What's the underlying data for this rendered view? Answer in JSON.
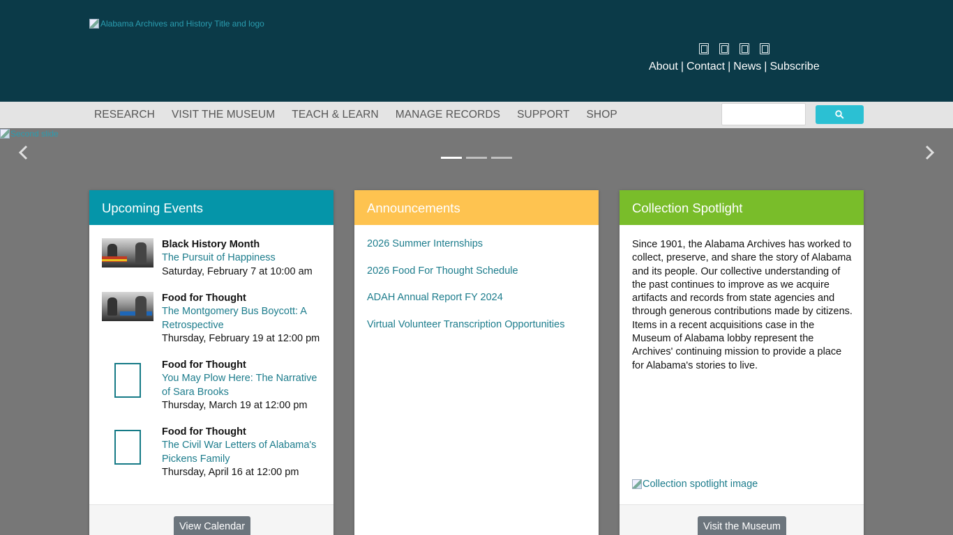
{
  "header": {
    "logo_alt": "Alabama Archives and History Title and logo",
    "social_icons": [
      "facebook-icon",
      "twitter-icon",
      "instagram-icon",
      "youtube-icon"
    ],
    "links": [
      "About",
      "Contact",
      "News",
      "Subscribe"
    ]
  },
  "nav": {
    "items": [
      "RESEARCH",
      "VISIT THE MUSEUM",
      "TEACH & LEARN",
      "MANAGE RECORDS",
      "SUPPORT",
      "SHOP"
    ],
    "search_value": ""
  },
  "carousel": {
    "slide_alt": "Second slide",
    "slide_count": 3,
    "active_index": 0
  },
  "events": {
    "title": "Upcoming Events",
    "items": [
      {
        "category": "Black History Month",
        "title": "The Pursuit of Happiness",
        "date": "Saturday, February 7 at 10:00 am"
      },
      {
        "category": "Food for Thought",
        "title": "The Montgomery Bus Boycott: A Retrospective",
        "date": "Thursday, February 19 at 12:00 pm"
      },
      {
        "category": "Food for Thought",
        "title": "You May Plow Here: The Narrative of Sara Brooks",
        "date": "Thursday, March 19 at 12:00 pm"
      },
      {
        "category": "Food for Thought",
        "title": "The Civil War Letters of Alabama's Pickens Family",
        "date": "Thursday, April 16 at 12:00 pm"
      }
    ],
    "button": "View Calendar"
  },
  "announcements": {
    "title": "Announcements",
    "items": [
      "2026 Summer Internships",
      "2026 Food For Thought Schedule",
      "ADAH Annual Report FY 2024",
      "Virtual Volunteer Transcription Opportunities"
    ]
  },
  "spotlight": {
    "title": "Collection Spotlight",
    "text": "Since 1901, the Alabama Archives has worked to collect, preserve, and share the story of Alabama and its people. Our collective understanding of the past continues to improve as we acquire artifacts and records from state agencies and through generous contributions made by citizens. Items in a recent acquisitions case in the Museum of Alabama lobby represent the Archives' continuing mission to provide a place for Alabama's stories to live.",
    "image_alt": "Collection spotlight image",
    "button": "Visit the Museum"
  },
  "colors": {
    "header_bg": "#0b3a48",
    "events_accent": "#0595a9",
    "announcements_accent": "#fec350",
    "spotlight_accent": "#79bd2a",
    "search_button": "#2bc0d3",
    "link": "#1c7c8c"
  }
}
